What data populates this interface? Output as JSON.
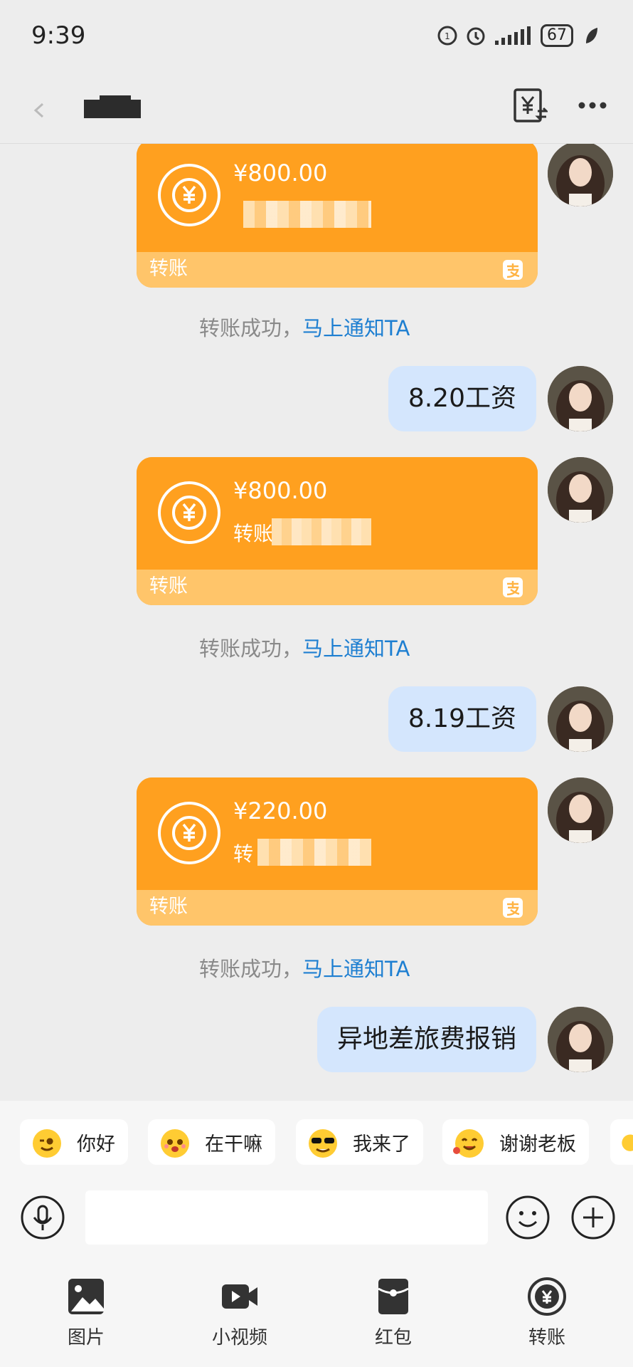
{
  "status_bar": {
    "time": "9:39",
    "battery": "67"
  },
  "header": {
    "icons": [
      "back-icon",
      "bill-icon",
      "more-icon"
    ]
  },
  "messages": [
    {
      "type": "transfer",
      "amount": "¥800.00",
      "memo": "",
      "label": "转账"
    },
    {
      "type": "system",
      "text": "转账成功，",
      "link": "马上通知TA"
    },
    {
      "type": "text",
      "text": "8.20工资"
    },
    {
      "type": "transfer",
      "amount": "¥800.00",
      "memo": "转账",
      "label": "转账"
    },
    {
      "type": "system",
      "text": "转账成功，",
      "link": "马上通知TA"
    },
    {
      "type": "text",
      "text": "8.19工资"
    },
    {
      "type": "transfer",
      "amount": "¥220.00",
      "memo": "转",
      "label": "转账"
    },
    {
      "type": "system",
      "text": "转账成功，",
      "link": "马上通知TA"
    },
    {
      "type": "text",
      "text": "异地差旅费报销"
    }
  ],
  "quick_replies": [
    "你好",
    "在干嘛",
    "我来了",
    "谢谢老板"
  ],
  "tabs": [
    "图片",
    "小视频",
    "红包",
    "转账"
  ],
  "colors": {
    "transfer": "#ffa01f",
    "transfer_footer": "#ffc56a",
    "bubble": "#d4e6fd",
    "link": "#1e7fd1"
  }
}
